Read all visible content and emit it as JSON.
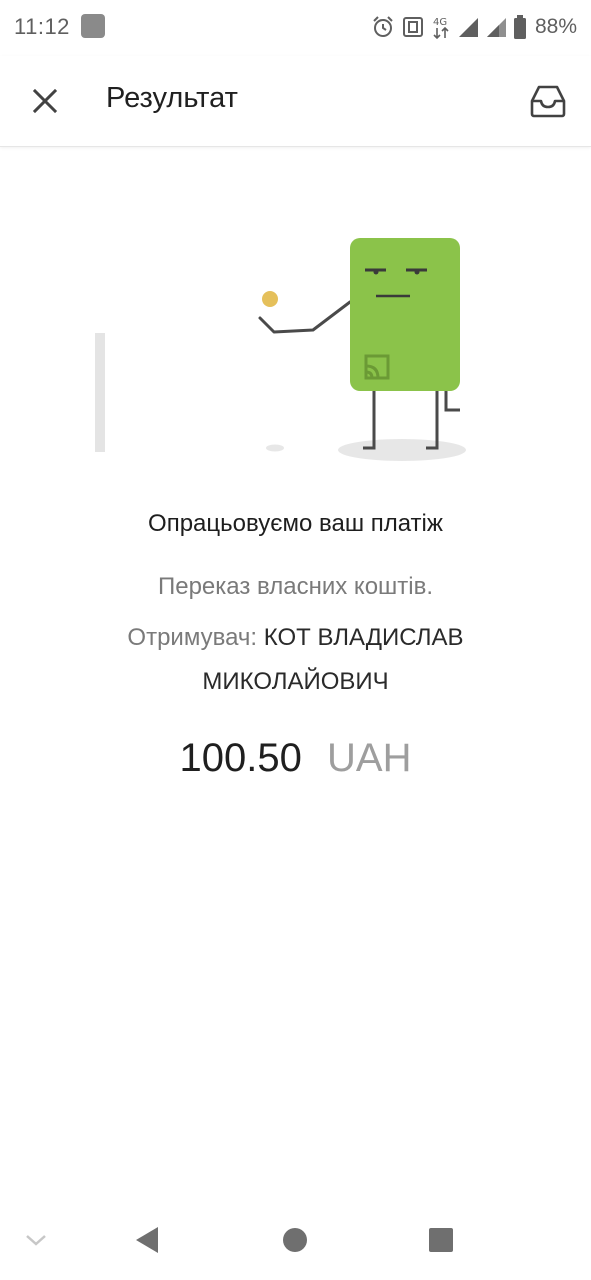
{
  "status_bar": {
    "time": "11:12",
    "network": "4G",
    "battery": "88%"
  },
  "app_bar": {
    "title": "Результат",
    "close_icon": "close-icon",
    "inbox_icon": "inbox-icon"
  },
  "result": {
    "title": "Опрацьовуємо ваш платіж",
    "transfer_type": "Переказ власних коштів.",
    "recipient_label": "Отримувач:",
    "recipient_name": "КОТ ВЛАДИСЛАВ МИКОЛАЙОВИЧ",
    "amount": "100.50",
    "currency": "UAH"
  },
  "colors": {
    "card_green": "#8bc34a",
    "coin_yellow": "#e5c05b"
  },
  "nav_bar": {
    "icons": [
      "chevron-down-icon",
      "back-icon",
      "home-icon",
      "recents-icon"
    ]
  }
}
